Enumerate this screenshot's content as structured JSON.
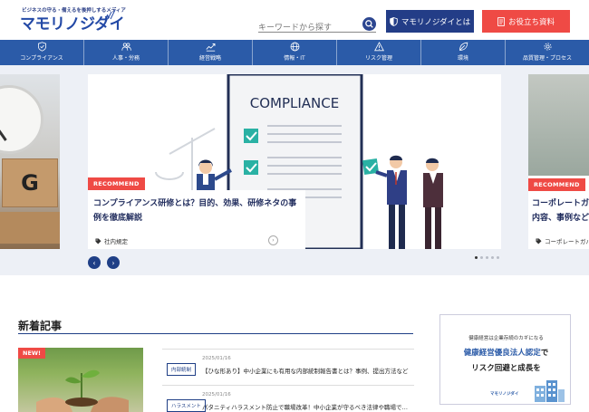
{
  "header": {
    "tagline": "ビジネスの守る・備えるを後押しするメディア",
    "logo": "マモリノジダイ",
    "search_placeholder": "キーワードから探す",
    "about_label": "マモリノジダイとは",
    "docs_label": "お役立ち資料"
  },
  "nav": [
    {
      "label": "コンプライアンス",
      "icon": "shield-check-icon"
    },
    {
      "label": "人事・労務",
      "icon": "people-icon"
    },
    {
      "label": "経営戦略",
      "icon": "chart-icon"
    },
    {
      "label": "情報・IT",
      "icon": "globe-icon"
    },
    {
      "label": "リスク管理",
      "icon": "warning-icon"
    },
    {
      "label": "環境",
      "icon": "leaf-icon"
    },
    {
      "label": "品質管理・プロセス",
      "icon": "gear-icon"
    }
  ],
  "hero": {
    "slides": [
      {
        "image_label": "G"
      },
      {
        "badge": "RECOMMEND",
        "image_text": "COMPLIANCE",
        "title_line1": "コンプライアンス研修とは？目的、効果、研修ネタの事",
        "title_line2": "例を徹底解説",
        "tag": "社内規定"
      },
      {
        "badge": "RECOMMEND",
        "title_line1": "コーポレートガバナンスとは？目的、意味や",
        "title_line2": "内容、事例などを",
        "tag": "コーポレートガバナンス"
      }
    ],
    "prev_label": "‹",
    "next_label": "›"
  },
  "latest": {
    "title": "新着記事",
    "new_badge": "NEW!",
    "items": [
      {
        "category": "内部統制",
        "date": "2025/01/16",
        "title": "【ひな形あり】中小企業にも有用な内部統制報告書とは？事例、提出方法など"
      },
      {
        "category": "ハラスメント",
        "date": "2025/01/16",
        "title": "パタニティハラスメント防止で職場改革！中小企業が守るべき法律や職場で…"
      }
    ]
  },
  "ad": {
    "sub": "健康経営は企業存続のカギになる",
    "line1_blue": "健康経営優良法人認定",
    "line1_rest": "で",
    "line2": "リスク回避と成長を",
    "logo": "マモリノジダイ"
  },
  "colors": {
    "brand": "#2349a6",
    "nav": "#2b5ba8",
    "accent": "#ef4a45",
    "dark_blue": "#233d87"
  }
}
